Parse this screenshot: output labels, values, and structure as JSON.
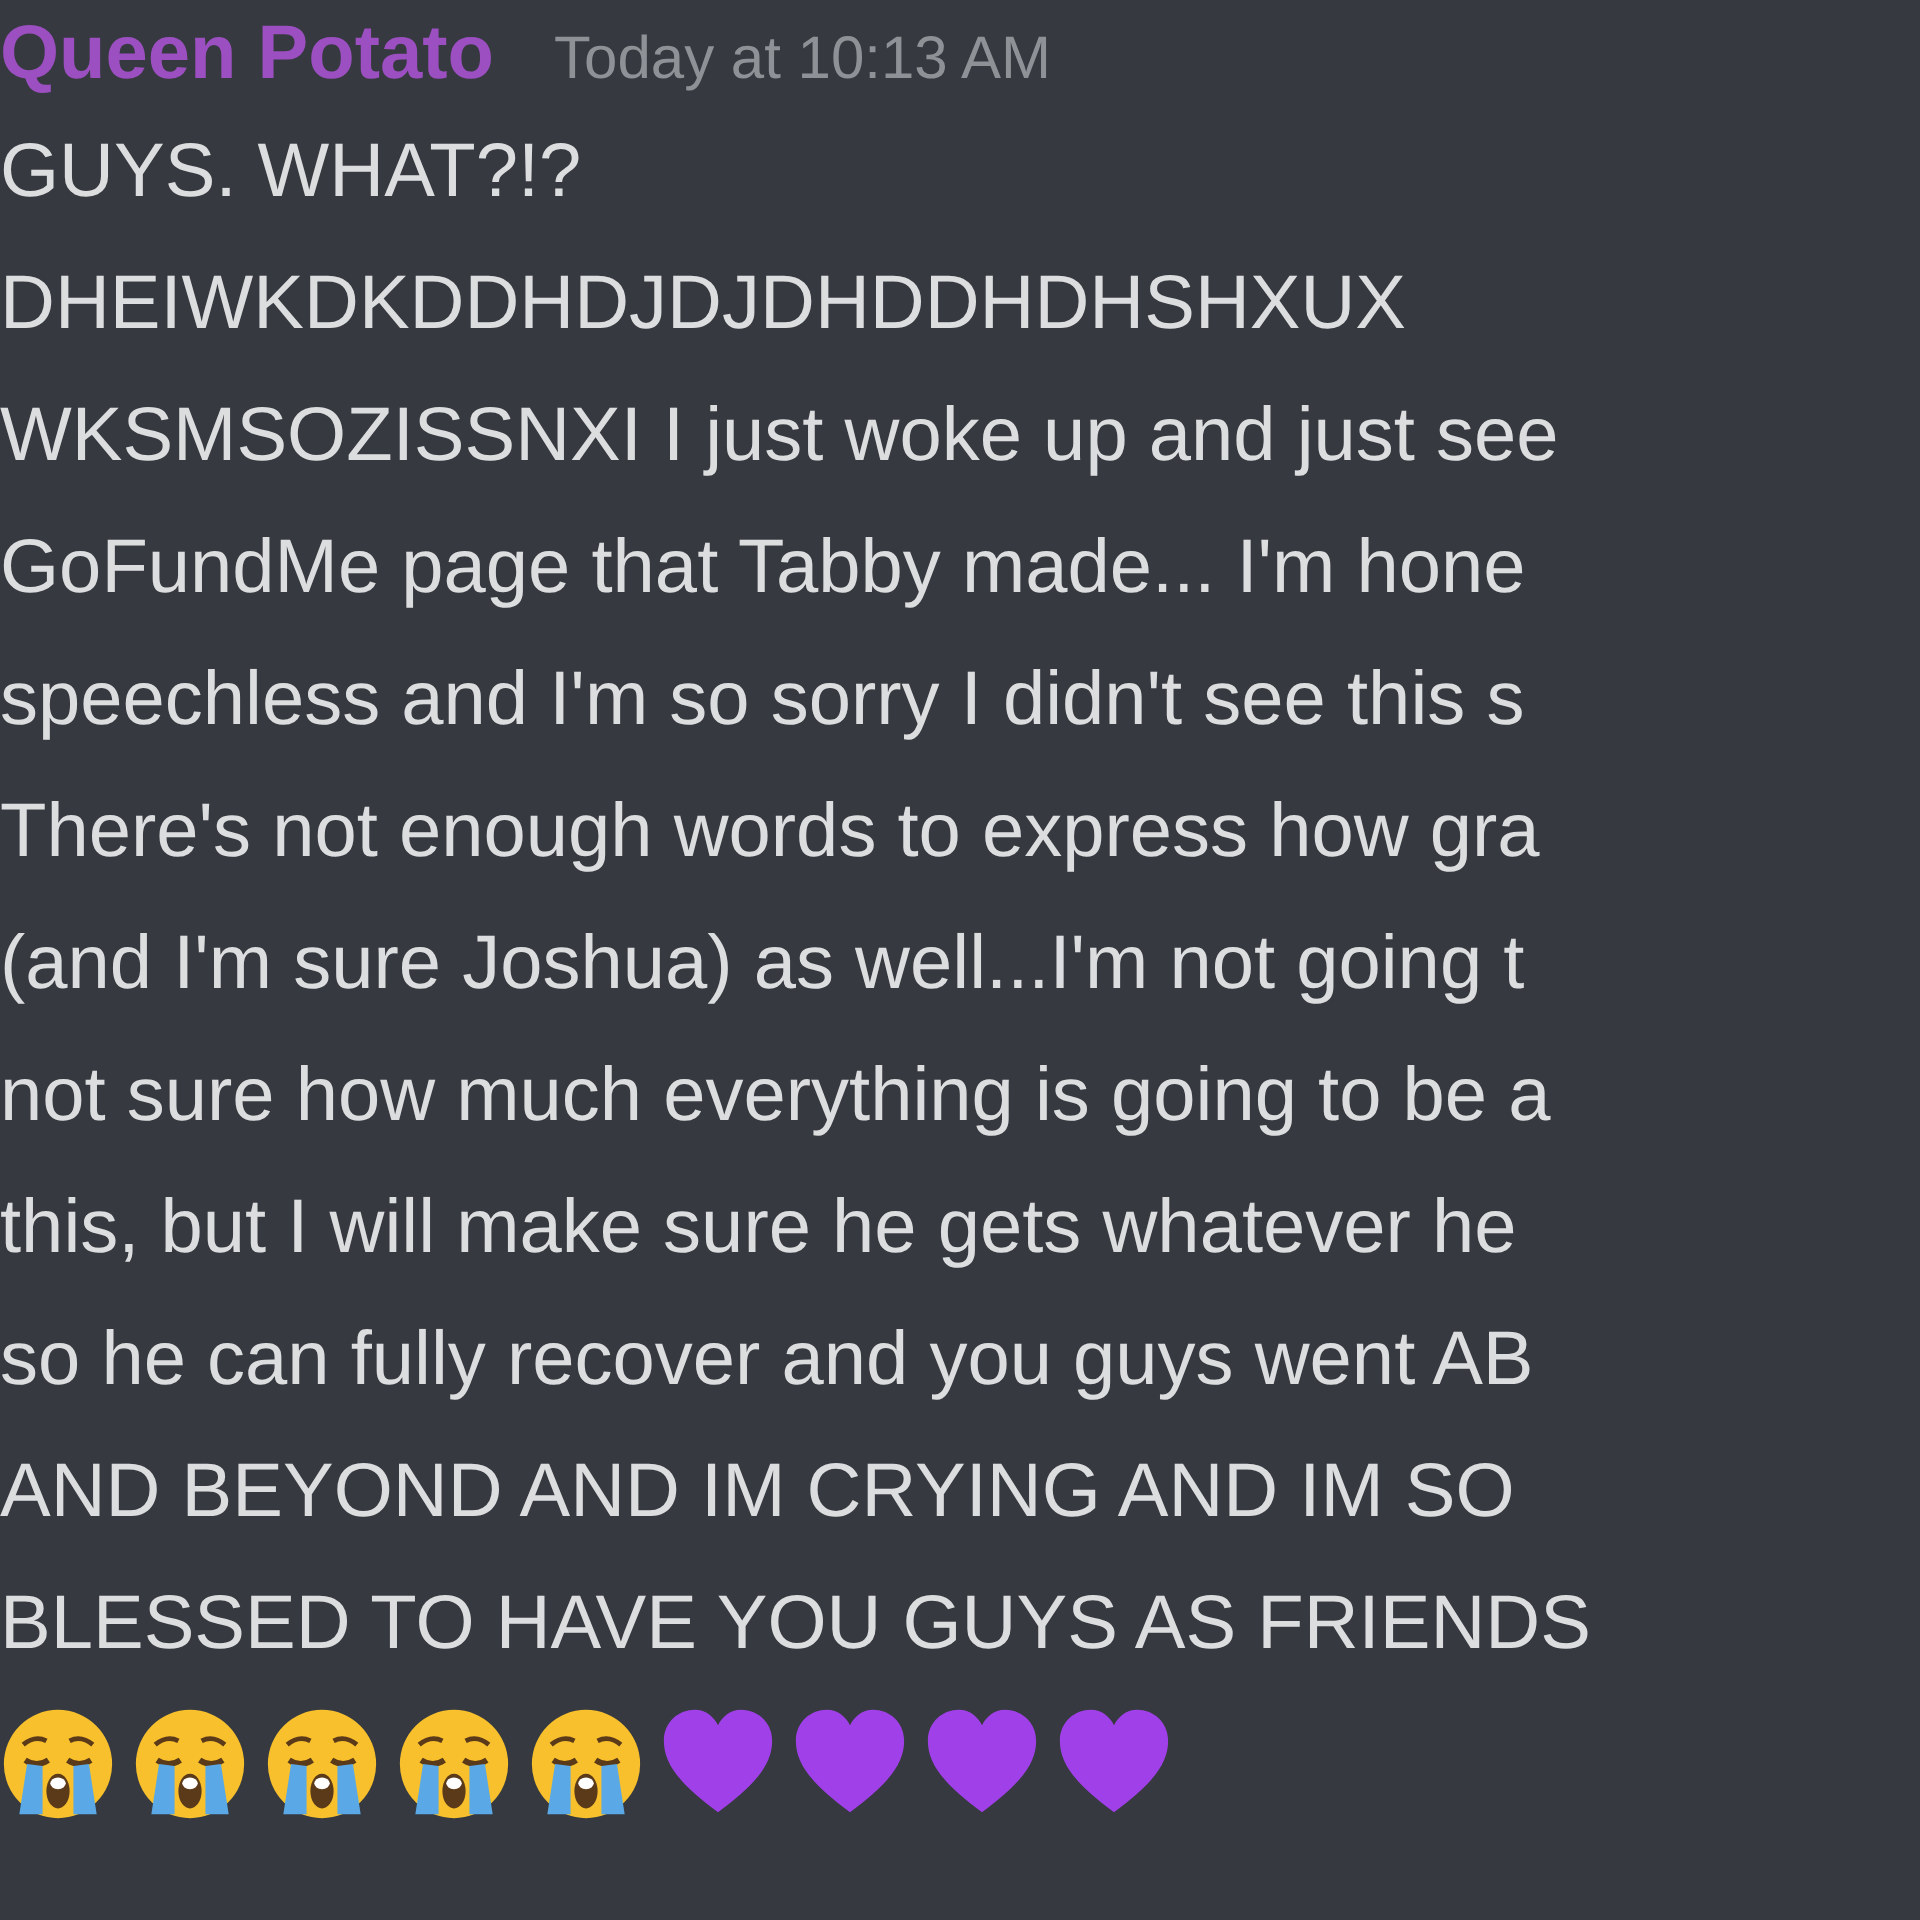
{
  "message": {
    "author": "Queen Potato",
    "timestamp": "Today at 10:13 AM",
    "lines": [
      "GUYS. WHAT?!?",
      "DHEIWKDKDDHDJDJDHDDHDHSHXUX",
      "WKSMSOZISSNXI I just woke up and just see",
      "GoFundMe page that Tabby made... I'm hone",
      "speechless and I'm so sorry I didn't see this s",
      "There's not enough words to express how gra",
      "(and I'm sure Joshua) as well...I'm not going t",
      "not sure how much everything is going to be a",
      "this, but I will make sure he gets whatever he",
      "so he can fully recover and you guys went AB",
      "AND BEYOND AND IM CRYING AND IM SO",
      "BLESSED TO HAVE YOU GUYS AS FRIENDS"
    ],
    "emoji": [
      {
        "kind": "crying"
      },
      {
        "kind": "crying"
      },
      {
        "kind": "crying"
      },
      {
        "kind": "crying"
      },
      {
        "kind": "crying"
      },
      {
        "kind": "purple-heart"
      },
      {
        "kind": "purple-heart"
      },
      {
        "kind": "purple-heart"
      },
      {
        "kind": "purple-heart"
      }
    ]
  }
}
